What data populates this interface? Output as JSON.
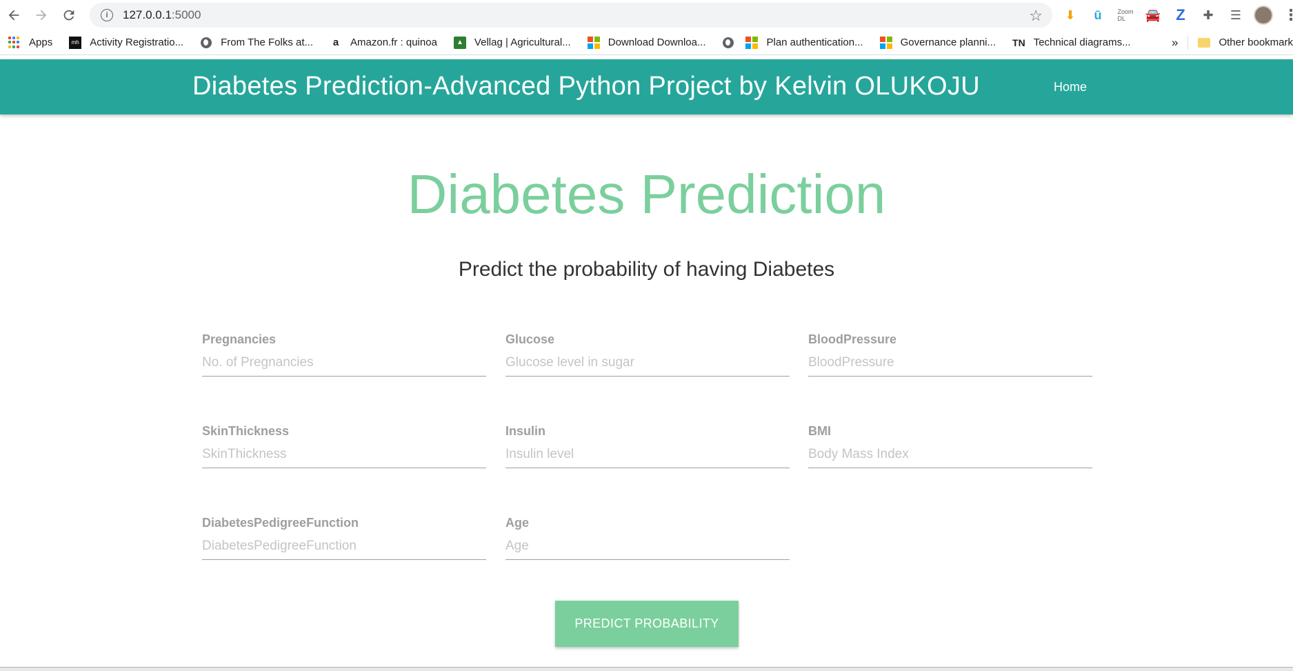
{
  "browser": {
    "url_host": "127.0.0.1",
    "url_port": ":5000",
    "bookmarks": [
      {
        "label": "Apps",
        "icon": "apps-grid-icon"
      },
      {
        "label": "Activity Registratio...",
        "icon": "mh-logo-icon"
      },
      {
        "label": "From The Folks at...",
        "icon": "globe-icon"
      },
      {
        "label": "Amazon.fr : quinoa",
        "icon": "amazon-icon"
      },
      {
        "label": "Vellag | Agricultural...",
        "icon": "tractor-icon"
      },
      {
        "label": "Download Downloa...",
        "icon": "microsoft-icon"
      },
      {
        "label": "",
        "icon": "globe-icon"
      },
      {
        "label": "Plan authentication...",
        "icon": "microsoft-icon"
      },
      {
        "label": "Governance planni...",
        "icon": "microsoft-icon"
      },
      {
        "label": "Technical diagrams...",
        "icon": "tn-icon",
        "icon_text": "TN"
      }
    ],
    "more_bookmarks": "»",
    "other_bookmarks": "Other bookmark"
  },
  "header": {
    "title": "Diabetes Prediction-Advanced Python Project by Kelvin OLUKOJU",
    "home": "Home"
  },
  "main": {
    "title": "Diabetes Prediction",
    "subtitle": "Predict the probability of having Diabetes",
    "fields": [
      {
        "label": "Pregnancies",
        "placeholder": "No. of Pregnancies"
      },
      {
        "label": "Glucose",
        "placeholder": "Glucose level in sugar"
      },
      {
        "label": "BloodPressure",
        "placeholder": "BloodPressure"
      },
      {
        "label": "SkinThickness",
        "placeholder": "SkinThickness"
      },
      {
        "label": "Insulin",
        "placeholder": "Insulin level"
      },
      {
        "label": "BMI",
        "placeholder": "Body Mass Index"
      },
      {
        "label": "DiabetesPedigreeFunction",
        "placeholder": "DiabetesPedigreeFunction"
      },
      {
        "label": "Age",
        "placeholder": "Age"
      }
    ],
    "submit": "PREDICT PROBABILITY"
  },
  "colors": {
    "header_bg": "#26a69a",
    "accent_green": "#7bcf9d"
  }
}
